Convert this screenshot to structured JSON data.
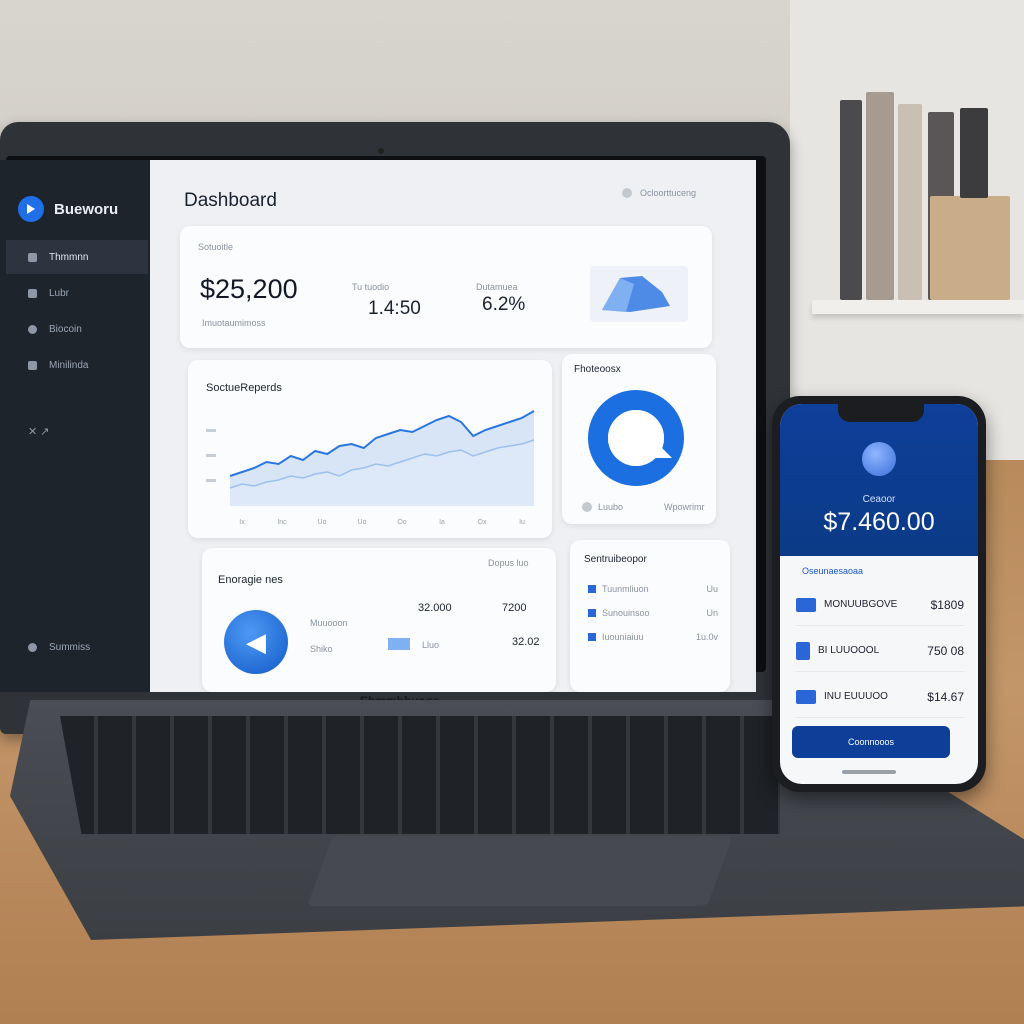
{
  "laptop": {
    "brand_label": "Ebmmbhuage",
    "sidebar": {
      "brand": "Bueworu",
      "items": [
        {
          "label": "Thmmnn",
          "icon": "menu-icon"
        },
        {
          "label": "Lubr",
          "icon": "folder-icon"
        },
        {
          "label": "Biocoin",
          "icon": "gear-icon"
        },
        {
          "label": "Minilinda",
          "icon": "document-icon"
        },
        {
          "label": "",
          "icon": "link-icon"
        },
        {
          "label": "Summiss",
          "icon": "settings-icon"
        }
      ]
    },
    "header": {
      "title": "Dashboard",
      "user_label": "Ocloorttuceng"
    },
    "summary": {
      "label_top": "Sotuoitle",
      "amount": "$25,200",
      "sub_label": "Imuotaumimoss",
      "metric1_label": "Tu tuodio",
      "metric1_value": "1.4:50",
      "metric2_label": "Dutamuea",
      "metric2_value": "6.2%"
    },
    "reports": {
      "title": "SoctueReperds",
      "x_ticks": [
        "Ix",
        "Inc",
        "Uo",
        "Uo",
        "Oo",
        "Ia",
        "Ox",
        "Iu"
      ]
    },
    "donut_card": {
      "title": "Fhoteoosx",
      "legend_left": "Luubo",
      "legend_right": "Wpowrimr"
    },
    "expenses": {
      "title": "Enoragie nes",
      "right_label": "Dopus luo",
      "row1": {
        "name": "Muuooon",
        "col1": "32.000",
        "col2": "7200"
      },
      "row2": {
        "name": "Shiko",
        "col1": "Lluo",
        "col2": "32.02"
      }
    },
    "transactions": {
      "title": "Sentruibeopor",
      "rows": [
        {
          "name": "Tuunmliuon",
          "value": "Uu"
        },
        {
          "name": "Sunouinsoo",
          "value": "Un"
        },
        {
          "name": "Iuouniaiuu",
          "value": "1u.0v"
        }
      ]
    }
  },
  "phone": {
    "balance_label": "Ceaoor",
    "balance": "$7.460.00",
    "list_title": "Oseunaesaoaa",
    "rows": [
      {
        "name": "MONUUBGOVE",
        "value": "$1809"
      },
      {
        "name": "BI LUUOOOL",
        "value": "750 08"
      },
      {
        "name": "INU EUUUOO",
        "value": "$14.67"
      }
    ],
    "button_label": "Coonnooos"
  },
  "chart_data": {
    "type": "area",
    "title": "SoctueReperds",
    "series": [
      {
        "values": [
          30,
          34,
          38,
          44,
          42,
          50,
          46,
          55,
          52,
          60,
          62,
          58,
          68,
          72,
          76,
          74,
          80,
          86,
          90,
          84,
          70,
          76,
          80,
          84,
          88,
          95
        ]
      },
      {
        "values": [
          18,
          22,
          20,
          24,
          26,
          30,
          28,
          32,
          34,
          30,
          36,
          38,
          42,
          40,
          44,
          48,
          52,
          50,
          54,
          56,
          50,
          54,
          58,
          60,
          62,
          66
        ]
      }
    ],
    "ylim": [
      0,
      100
    ],
    "grid": false
  },
  "colors": {
    "accent": "#1f6fe8",
    "phone_header": "#0d3f98",
    "sidebar": "#1e242c"
  }
}
